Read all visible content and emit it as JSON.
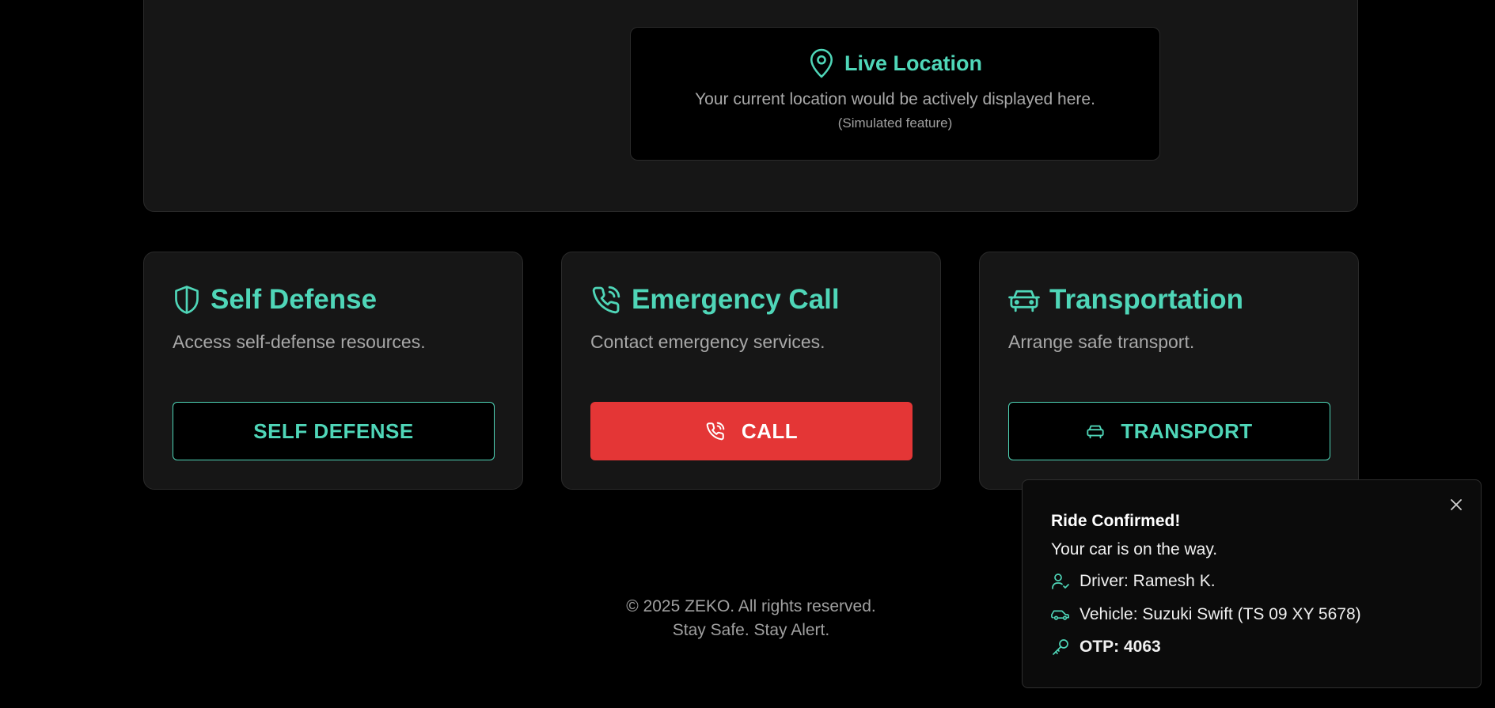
{
  "colors": {
    "accent": "#4fd6b8",
    "danger": "#e43636",
    "background": "#000000",
    "panel": "#161616"
  },
  "location": {
    "icon": "map-pin-icon",
    "title": "Live Location",
    "text": "Your current location would be actively displayed here.",
    "note": "(Simulated feature)"
  },
  "cards": [
    {
      "icon": "shield-icon",
      "title": "Self Defense",
      "desc": "Access self-defense resources.",
      "button": "SELF DEFENSE"
    },
    {
      "icon": "phone-call-icon",
      "title": "Emergency Call",
      "desc": "Contact emergency services.",
      "button": "CALL"
    },
    {
      "icon": "car-icon",
      "title": "Transportation",
      "desc": "Arrange safe transport.",
      "button": "TRANSPORT"
    }
  ],
  "footer": {
    "copyright": "© 2025 ZEKO. All rights reserved.",
    "tagline": "Stay Safe. Stay Alert."
  },
  "toast": {
    "title": "Ride Confirmed!",
    "message": "Your car is on the way.",
    "driver": "Driver: Ramesh K.",
    "vehicle": "Vehicle: Suzuki Swift (TS 09 XY 5678)",
    "otp": "OTP: 4063"
  }
}
